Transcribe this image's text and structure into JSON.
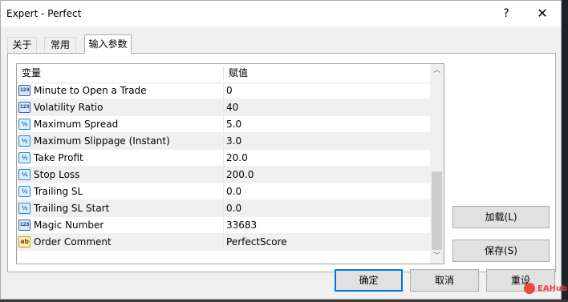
{
  "window": {
    "title": "Expert - Perfect",
    "help_glyph": "?",
    "close_glyph": "✕"
  },
  "tabs": [
    {
      "label": "关于"
    },
    {
      "label": "常用"
    },
    {
      "label": "输入参数",
      "active": true
    }
  ],
  "grid": {
    "columns": [
      "变量",
      "赋值"
    ],
    "rows": [
      {
        "type": "int",
        "icon": "123",
        "name": "Minute to Open a Trade",
        "value": "0"
      },
      {
        "type": "int",
        "icon": "123",
        "name": "Volatility Ratio",
        "value": "40"
      },
      {
        "type": "double",
        "icon": "½",
        "name": "Maximum Spread",
        "value": "5.0"
      },
      {
        "type": "double",
        "icon": "½",
        "name": "Maximum Slippage (Instant)",
        "value": "3.0"
      },
      {
        "type": "double",
        "icon": "½",
        "name": "Take Profit",
        "value": "20.0"
      },
      {
        "type": "double",
        "icon": "½",
        "name": "Stop Loss",
        "value": "200.0"
      },
      {
        "type": "double",
        "icon": "½",
        "name": "Trailing SL",
        "value": "0.0"
      },
      {
        "type": "double",
        "icon": "½",
        "name": "Trailing SL Start",
        "value": "0.0"
      },
      {
        "type": "int",
        "icon": "123",
        "name": "Magic Number",
        "value": "33683"
      },
      {
        "type": "string",
        "icon": "ab",
        "name": "Order Comment",
        "value": "PerfectScore"
      }
    ],
    "scroll_up_glyph": "︿",
    "scroll_down_glyph": "﹀"
  },
  "buttons": {
    "load": "加载(L)",
    "save": "保存(S)",
    "ok": "确定",
    "cancel": "取消",
    "reset": "重设"
  },
  "watermark": {
    "text": "EAHub"
  },
  "colors": {
    "accent": "#0078d7",
    "row_alt": "#f0f0f0",
    "button_face": "#e1e1e1"
  }
}
